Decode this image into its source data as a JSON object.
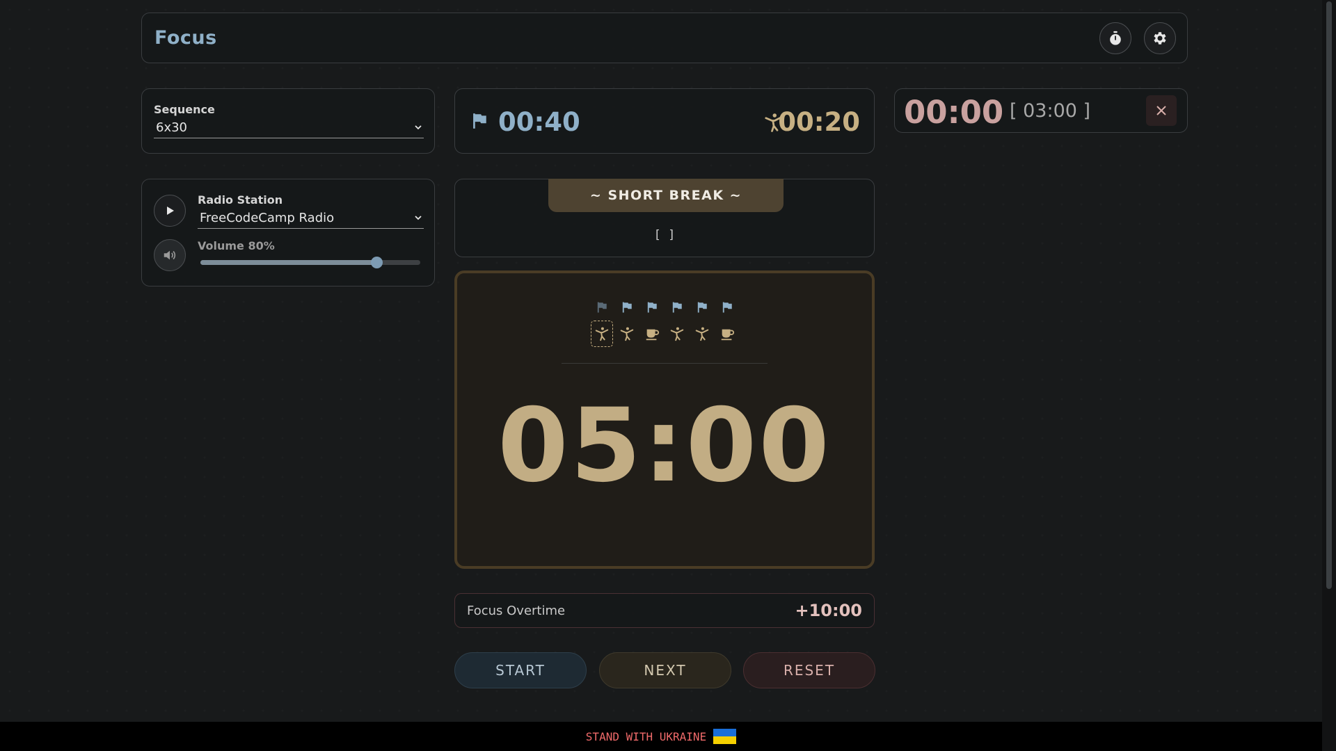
{
  "header": {
    "title": "Focus"
  },
  "sequence": {
    "label": "Sequence",
    "value": "6x30"
  },
  "radio": {
    "label": "Radio Station",
    "value": "FreeCodeCamp Radio",
    "volume_label": "Volume 80%",
    "volume_level": 0.8
  },
  "durations": {
    "focus": "00:40",
    "break": "00:20"
  },
  "clock": {
    "time": "00:00",
    "target": "[ 03:00 ]"
  },
  "mode": {
    "label": "~ SHORT BREAK ~",
    "note": "[ ]"
  },
  "sequence_icons": {
    "focus_row": [
      "flag-icon",
      "flag-icon",
      "flag-icon",
      "flag-icon",
      "flag-icon",
      "flag-icon"
    ],
    "break_row": [
      "stretch-icon",
      "stretch-icon",
      "coffee-icon",
      "stretch-icon",
      "stretch-icon",
      "coffee-icon"
    ],
    "completed_focus": 1,
    "current_break_index": 0
  },
  "timer": {
    "display": "05:00"
  },
  "overtime": {
    "label": "Focus Overtime",
    "value": "+10:00"
  },
  "actions": {
    "start": "START",
    "next": "NEXT",
    "reset": "RESET"
  },
  "footer": {
    "text": "STAND WITH UKRAINE"
  },
  "colors": {
    "focus_accent": "#8fb0c8",
    "break_accent": "#c7b083",
    "clock_accent": "#c9a19f",
    "footer_text": "#f06a6a"
  }
}
